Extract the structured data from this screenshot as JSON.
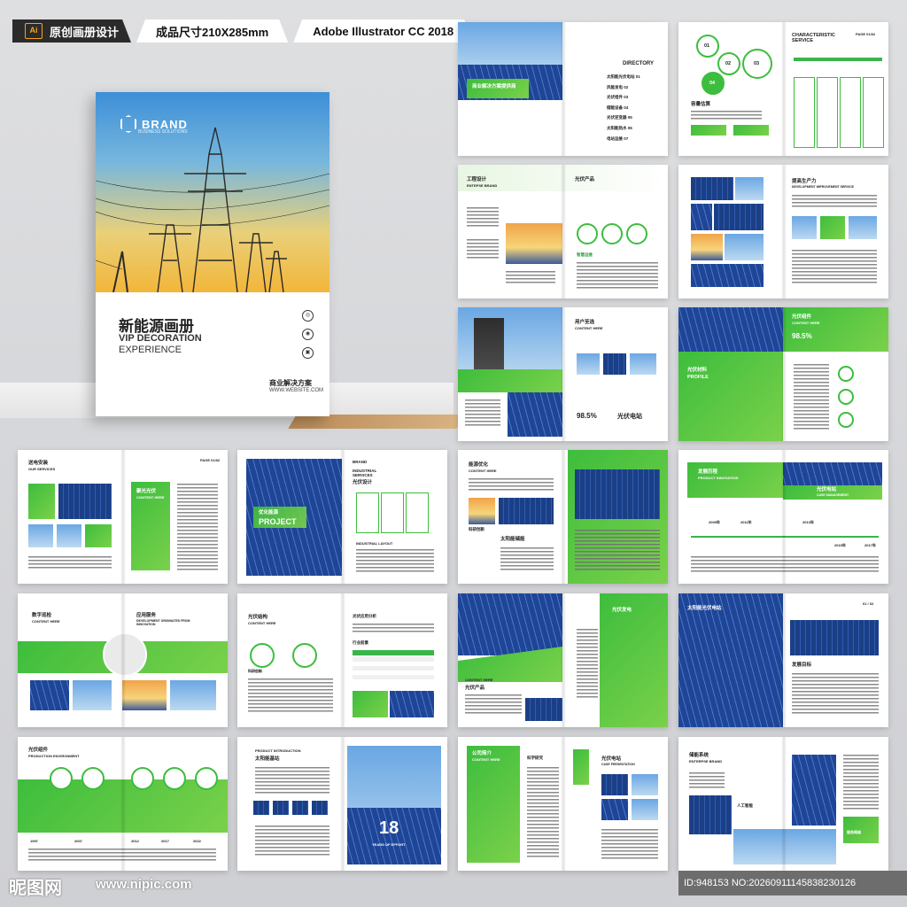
{
  "topbar": {
    "ai_badge": "Ai",
    "tag1": "原创画册设计",
    "tag2": "成品尺寸210X285mm",
    "tag3": "Adobe Illustrator CC 2018"
  },
  "cover": {
    "brand": "BRAND",
    "brand_sub": "BUSINESS SOLUTIONS",
    "title": "新能源画册",
    "subtitle_line1": "VIP DECORATION",
    "subtitle_line2": "EXPERIENCE",
    "icon1": "◎",
    "icon2": "◉",
    "icon3": "▣",
    "plan": "商业解决方案",
    "website": "WWW.WEBSITE.COM"
  },
  "spreads": {
    "s1": {
      "directory": "DIRECTORY",
      "caption": "商业解决方案提供商",
      "items": [
        "太阳能光伏电站 01",
        "风能发电 02",
        "光伏组件 03",
        "储能设备 04",
        "光伏逆变器 05",
        "太阳能热水 06",
        "电站运维 07"
      ]
    },
    "s2": {
      "title": "CHARACTERISTIC SERVICE",
      "page": "PAGE 01/02",
      "left": "容量估算",
      "n1": "01",
      "n2": "02",
      "n3": "03",
      "n4": "04"
    },
    "s3": {
      "title": "工程设计",
      "en": "ENTEPSE BRAND",
      "right": "光伏产品",
      "sub": "智慧运维"
    },
    "s4": {
      "title": "提高生产力",
      "en": "DEVELOPMENT IMPROVEMENT SERVICE"
    },
    "s5": {
      "title": "用户至选",
      "en": "CONTENT HERE",
      "pct": "98.5%",
      "station": "光伏电站"
    },
    "s6": {
      "title": "光伏组件",
      "en": "CONTENT HERE",
      "pct": "98.5%",
      "profile": "光伏材料",
      "profile_en": "PROFILE"
    },
    "s7": {
      "title": "送电安装",
      "en": "OUR SERVICES",
      "right": "聚光光伏",
      "right_en": "CONTENT HERE",
      "page": "PAGE 01/02"
    },
    "s8": {
      "brand": "BRAND",
      "title": "INDUSTRIAL SERVICES",
      "sub": "光伏设计",
      "project_cn": "优化能源",
      "project": "PROJECT",
      "layout": "INDUSTRIAL LAYOUT"
    },
    "s9": {
      "title": "能源优化",
      "en": "CONTENT HERE",
      "storage": "太阳能储能",
      "sub": "科研创新"
    },
    "s10": {
      "title": "发展历程",
      "en": "PRODUCT INNOVATION",
      "right": "光伏电站",
      "right_en": "CASE MANAGEMENT",
      "years": [
        "2009年",
        "2011年",
        "2013年",
        "2015年",
        "2017年"
      ]
    },
    "s11": {
      "title": "数字巡检",
      "en": "CONTENT HERE",
      "right": "应用服务",
      "right_en": "DEVELOPMENT ORIGINATES FROM INNOVATION"
    },
    "s12": {
      "title": "光伏结构",
      "en": "CONTENT HERE",
      "table": "光伏应用分析",
      "row": "行业前景",
      "sub": "科研创新"
    },
    "s13": {
      "title": "光伏发电",
      "en": "CONTENT HERE",
      "sub": "光伏产品"
    },
    "s14": {
      "title": "太阳能光伏电站",
      "sub": "发展目标",
      "page": "01 / 02"
    },
    "s15": {
      "title": "光伏组件",
      "en": "PRODUCTION ENVIRONMENT",
      "years": [
        "1997",
        "2007",
        "2012",
        "2017",
        "2022"
      ]
    },
    "s16": {
      "title": "太阳能基站",
      "en": "PRODUCT INTRODUCTION",
      "num": "18",
      "years": "YEARS OF EFFORT"
    },
    "s17": {
      "title": "公司简介",
      "en": "CONTENT HERE",
      "right": "光伏电站",
      "right_en": "CASE PRESENTATION",
      "sub": "科学研究"
    },
    "s18": {
      "title": "储能系统",
      "en": "ENTERPSE BRAND",
      "sub": "人工智能",
      "sub2": "服务网络"
    }
  },
  "footer": {
    "logo": "昵图网",
    "url": "www.nipic.com",
    "id": "ID:948153 NO:20260911145838230126"
  }
}
